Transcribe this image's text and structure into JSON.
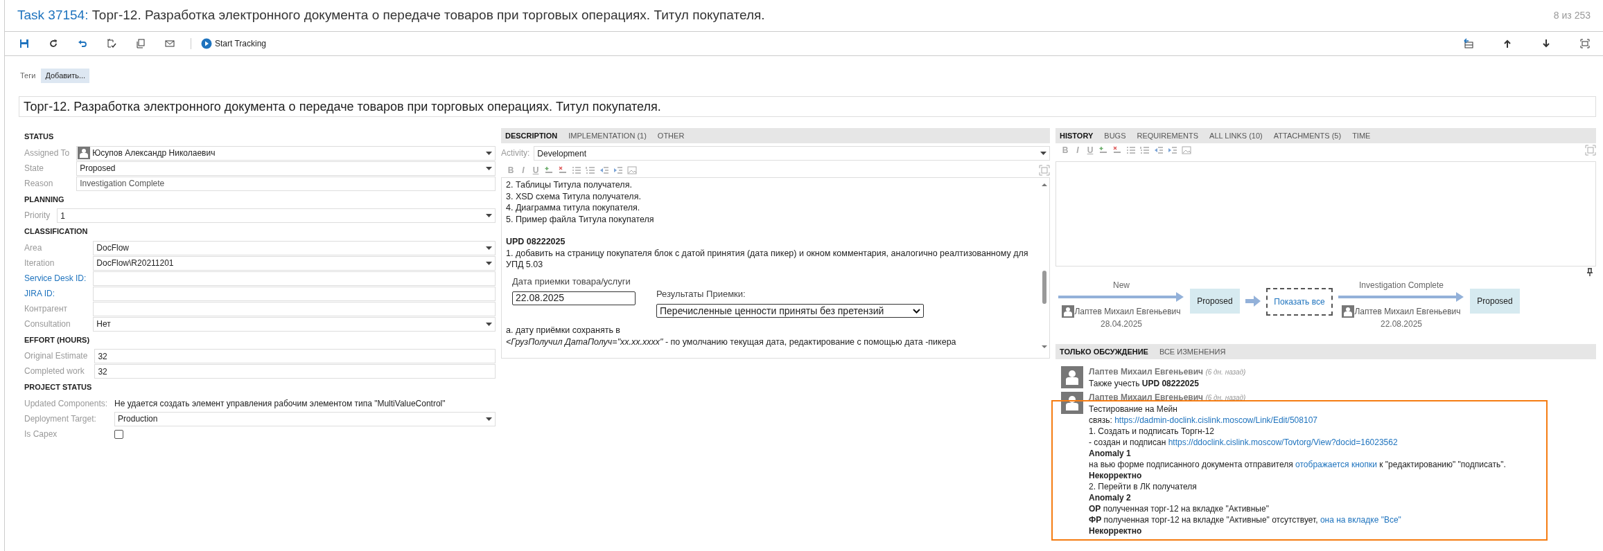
{
  "header": {
    "task_link": "Task 37154:",
    "title": "Торг-12. Разработка электронного документа о передаче товаров при торговых операциях. Титул покупателя.",
    "counter": "8 из 253"
  },
  "toolbar": {
    "start_tracking": "Start Tracking"
  },
  "tags": {
    "label": "Теги",
    "add_button": "Добавить..."
  },
  "title_field": {
    "value": "Торг-12. Разработка электронного документа о передаче товаров при торговых операциях. Титул покупателя."
  },
  "sections": [
    {
      "title": "STATUS",
      "fields": [
        {
          "label": "Assigned To",
          "kind": "person",
          "value": "Юсупов Александр Николаевич",
          "link": false
        },
        {
          "label": "State",
          "kind": "dropdown",
          "value": "Proposed",
          "link": false
        },
        {
          "label": "Reason",
          "kind": "readonly",
          "value": "Investigation Complete",
          "link": false
        }
      ]
    },
    {
      "title": "PLANNING",
      "fields": [
        {
          "label": "Priority",
          "kind": "dropdown",
          "value": "1",
          "link": false
        }
      ]
    },
    {
      "title": "CLASSIFICATION",
      "fields": [
        {
          "label": "Area",
          "kind": "dropdown",
          "value": "DocFlow",
          "link": false
        },
        {
          "label": "Iteration",
          "kind": "dropdown",
          "value": "DocFlow\\R20211201",
          "link": false
        },
        {
          "label": "Service Desk ID:",
          "kind": "input",
          "link": true
        },
        {
          "label": "JIRA ID:",
          "kind": "input",
          "link": true
        },
        {
          "label": "Контрагент",
          "kind": "input",
          "link": false
        },
        {
          "label": "Consultation",
          "kind": "dropdown",
          "value": "Нет",
          "link": false
        }
      ]
    },
    {
      "title": "EFFORT (HOURS)",
      "fields": [
        {
          "label": "Original Estimate",
          "kind": "input",
          "value": "32",
          "link": false
        },
        {
          "label": "Completed work",
          "kind": "input",
          "value": "32",
          "link": false
        }
      ]
    },
    {
      "title": "PROJECT STATUS",
      "fields": [
        {
          "label": "Updated Components:",
          "kind": "plain",
          "value": "Не удается создать элемент управления рабочим элементом типа \"MultiValueControl\"",
          "link": false
        },
        {
          "label": "Deployment Target:",
          "kind": "dropdown",
          "value": "Production",
          "link": false
        },
        {
          "label": "Is Capex",
          "kind": "checkbox",
          "checked": false,
          "link": false
        }
      ]
    }
  ],
  "description": {
    "tabs": [
      {
        "label": "DESCRIPTION",
        "selected": true
      },
      {
        "label": "IMPLEMENTATION (1)",
        "selected": false
      },
      {
        "label": "OTHER",
        "selected": false
      }
    ],
    "activity": {
      "label": "Activity:",
      "value": "Development"
    },
    "format_buttons": [
      "B",
      "I",
      "U"
    ],
    "content": [
      {
        "kind": "line",
        "text": "2. Таблицы Титула получателя."
      },
      {
        "kind": "line",
        "text": "3. XSD схема Титула получателя."
      },
      {
        "kind": "line",
        "text": "4. Диаграмма титула покупателя."
      },
      {
        "kind": "line",
        "text": "5. Пример файла Титула покупателя"
      },
      {
        "kind": "heading",
        "text": "UPD 08222025"
      },
      {
        "kind": "line",
        "text": "1.  добавить на страницу покупателя блок с датой принятия (дата пикер) и окном комментария, аналогично реалтизованному для УПД 5.03"
      },
      {
        "kind": "form_mock",
        "date_label": "Дата приемки товара/услуги",
        "date_value": "22.08.2025",
        "result_label": "Результаты Приемки:",
        "result_value": "Перечисленные ценности приняты без претензий"
      },
      {
        "kind": "line",
        "text": "а. дату приёмки сохранять в"
      },
      {
        "kind": "line",
        "text": "*<ГрузПолучил  ДатаПолуч=\"xx.xx.xxxx\"* - по умолчанию текущая дата, редактирование с помощью дата -пикера"
      }
    ]
  },
  "links_panel": {
    "tabs": [
      {
        "label": "HISTORY",
        "selected": true
      },
      {
        "label": "BUGS",
        "selected": false
      },
      {
        "label": "REQUIREMENTS",
        "selected": false
      },
      {
        "label": "ALL LINKS (10)",
        "selected": false
      },
      {
        "label": "ATTACHMENTS (5)",
        "selected": false
      },
      {
        "label": "TIME",
        "selected": false
      }
    ],
    "format_buttons": [
      "B",
      "I",
      "U"
    ],
    "flow": [
      {
        "kind": "transition",
        "label": "New",
        "state": "Proposed",
        "author": "Лаптев Михаил Евгеньевич",
        "date": "28.04.2025"
      },
      {
        "kind": "collapsed",
        "text": "Показать все"
      },
      {
        "kind": "transition",
        "label": "Investigation Complete",
        "state": "Proposed",
        "author": "Лаптев Михаил Евгеньевич",
        "date": "22.08.2025"
      }
    ],
    "discussion_tabs": [
      {
        "label": "ТОЛЬКО ОБСУЖДЕНИЕ",
        "selected": true
      },
      {
        "label": "ВСЕ ИЗМЕНЕНИЯ",
        "selected": false
      }
    ],
    "comments": [
      {
        "author": "Лаптев Михаил Евгеньевич",
        "time": "(6 дн. назад)",
        "highlighted": false,
        "lines": [
          [
            {
              "kind": "text",
              "text": "Также учесть **UPD 08222025**"
            }
          ]
        ]
      },
      {
        "author": "Лаптев Михаил Евгеньевич",
        "time": "(6 дн. назад)",
        "highlighted": true,
        "lines": [
          [
            {
              "kind": "text",
              "text": "Тестирование на Мейн"
            }
          ],
          [
            {
              "kind": "text",
              "text": "связь: "
            },
            {
              "kind": "link",
              "text": "https://dadmin-doclink.cislink.moscow/Link/Edit/508107"
            }
          ],
          [
            {
              "kind": "text",
              "text": "1. Создать и подписать Торгн-12"
            }
          ],
          [
            {
              "kind": "text",
              "text": "- создан и подписан "
            },
            {
              "kind": "link",
              "text": "https://ddoclink.cislink.moscow/Tovtorg/View?docid=16023562"
            }
          ],
          [
            {
              "kind": "strong",
              "text": "Anomaly 1"
            }
          ],
          [
            {
              "kind": "text",
              "text": "на вью форме подписанного документа отправителя "
            },
            {
              "kind": "link",
              "text": "отображается кнопки"
            },
            {
              "kind": "text",
              "text": " к \"редактированию\"  \"подписать\"."
            }
          ],
          [
            {
              "kind": "strong",
              "text": "Некорректно"
            }
          ],
          [
            {
              "kind": "text",
              "text": "2. Перейти в ЛК получателя"
            }
          ],
          [
            {
              "kind": "strong",
              "text": "Anomaly 2"
            }
          ],
          [
            {
              "kind": "text",
              "text": "**ОР** полученная торг-12 на вкладке \"Активные\""
            }
          ],
          [
            {
              "kind": "text",
              "text": "**ФР** полученная торг-12 на вкладке \"Активные\" отсутствует, "
            },
            {
              "kind": "link",
              "text": "она на вкладке \"Все\""
            }
          ],
          [
            {
              "kind": "strong",
              "text": "Некорректно"
            }
          ]
        ]
      }
    ]
  }
}
